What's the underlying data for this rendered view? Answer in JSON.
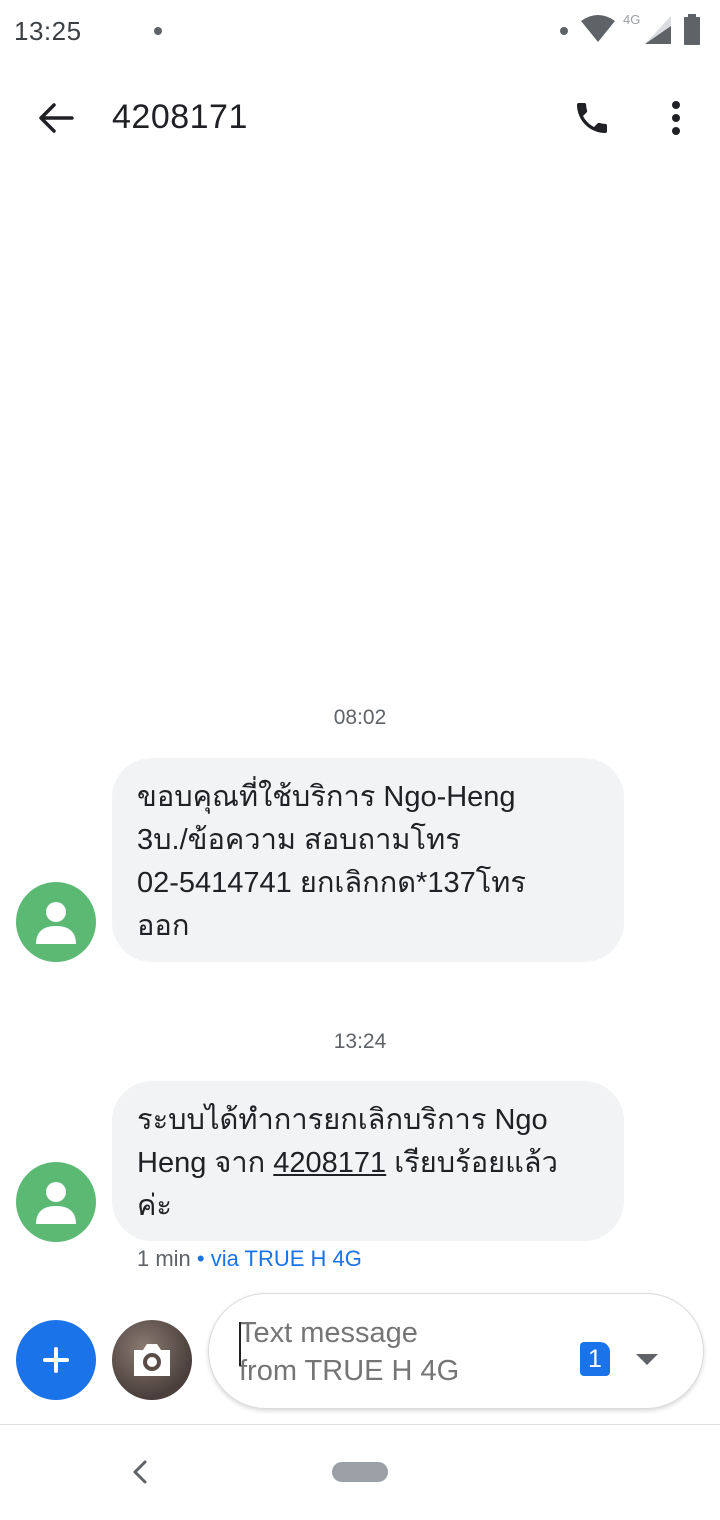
{
  "status_bar": {
    "time": "13:25",
    "network": "4G",
    "icons": [
      "notification-dot",
      "wifi-icon",
      "signal-icon",
      "battery-icon"
    ]
  },
  "header": {
    "title": "4208171",
    "icons": [
      "back-arrow-icon",
      "phone-icon",
      "more-vert-icon"
    ]
  },
  "messages": [
    {
      "timestamp": "08:02",
      "lines": [
        "ขอบคุณที่ใช้บริการ Ngo-Heng",
        "3บ./ข้อความ สอบถามโทร",
        "02-5414741 ยกเลิกกด*137โทร",
        "ออก"
      ]
    },
    {
      "timestamp": "13:24",
      "line1": "ระบบได้ทำการยกเลิกบริการ Ngo",
      "line2_prefix": "Heng จาก ",
      "line2_link": "4208171",
      "line2_suffix": " เรียบร้อยแล้ว",
      "line3": "ค่ะ",
      "meta_age": "1 min",
      "meta_via": " • via TRUE H 4G"
    }
  ],
  "compose": {
    "placeholder": "Text message\nfrom TRUE H 4G",
    "sim_number": "1",
    "icons": [
      "add-icon",
      "camera-icon",
      "dropdown-arrow-icon"
    ]
  },
  "colors": {
    "accent": "#1a73e8",
    "avatar": "#5bb974",
    "bubble": "#f1f3f4"
  }
}
